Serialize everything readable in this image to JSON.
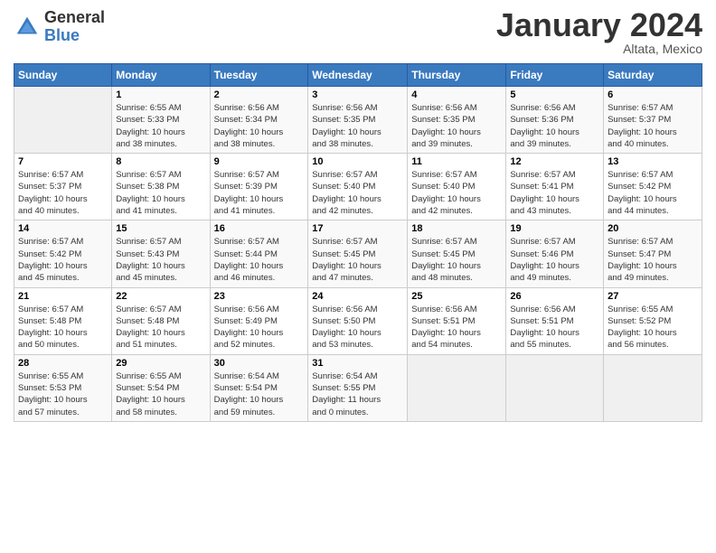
{
  "logo": {
    "general": "General",
    "blue": "Blue"
  },
  "title": "January 2024",
  "subtitle": "Altata, Mexico",
  "days_of_week": [
    "Sunday",
    "Monday",
    "Tuesday",
    "Wednesday",
    "Thursday",
    "Friday",
    "Saturday"
  ],
  "weeks": [
    [
      {
        "num": "",
        "detail": ""
      },
      {
        "num": "1",
        "detail": "Sunrise: 6:55 AM\nSunset: 5:33 PM\nDaylight: 10 hours\nand 38 minutes."
      },
      {
        "num": "2",
        "detail": "Sunrise: 6:56 AM\nSunset: 5:34 PM\nDaylight: 10 hours\nand 38 minutes."
      },
      {
        "num": "3",
        "detail": "Sunrise: 6:56 AM\nSunset: 5:35 PM\nDaylight: 10 hours\nand 38 minutes."
      },
      {
        "num": "4",
        "detail": "Sunrise: 6:56 AM\nSunset: 5:35 PM\nDaylight: 10 hours\nand 39 minutes."
      },
      {
        "num": "5",
        "detail": "Sunrise: 6:56 AM\nSunset: 5:36 PM\nDaylight: 10 hours\nand 39 minutes."
      },
      {
        "num": "6",
        "detail": "Sunrise: 6:57 AM\nSunset: 5:37 PM\nDaylight: 10 hours\nand 40 minutes."
      }
    ],
    [
      {
        "num": "7",
        "detail": "Sunrise: 6:57 AM\nSunset: 5:37 PM\nDaylight: 10 hours\nand 40 minutes."
      },
      {
        "num": "8",
        "detail": "Sunrise: 6:57 AM\nSunset: 5:38 PM\nDaylight: 10 hours\nand 41 minutes."
      },
      {
        "num": "9",
        "detail": "Sunrise: 6:57 AM\nSunset: 5:39 PM\nDaylight: 10 hours\nand 41 minutes."
      },
      {
        "num": "10",
        "detail": "Sunrise: 6:57 AM\nSunset: 5:40 PM\nDaylight: 10 hours\nand 42 minutes."
      },
      {
        "num": "11",
        "detail": "Sunrise: 6:57 AM\nSunset: 5:40 PM\nDaylight: 10 hours\nand 42 minutes."
      },
      {
        "num": "12",
        "detail": "Sunrise: 6:57 AM\nSunset: 5:41 PM\nDaylight: 10 hours\nand 43 minutes."
      },
      {
        "num": "13",
        "detail": "Sunrise: 6:57 AM\nSunset: 5:42 PM\nDaylight: 10 hours\nand 44 minutes."
      }
    ],
    [
      {
        "num": "14",
        "detail": "Sunrise: 6:57 AM\nSunset: 5:42 PM\nDaylight: 10 hours\nand 45 minutes."
      },
      {
        "num": "15",
        "detail": "Sunrise: 6:57 AM\nSunset: 5:43 PM\nDaylight: 10 hours\nand 45 minutes."
      },
      {
        "num": "16",
        "detail": "Sunrise: 6:57 AM\nSunset: 5:44 PM\nDaylight: 10 hours\nand 46 minutes."
      },
      {
        "num": "17",
        "detail": "Sunrise: 6:57 AM\nSunset: 5:45 PM\nDaylight: 10 hours\nand 47 minutes."
      },
      {
        "num": "18",
        "detail": "Sunrise: 6:57 AM\nSunset: 5:45 PM\nDaylight: 10 hours\nand 48 minutes."
      },
      {
        "num": "19",
        "detail": "Sunrise: 6:57 AM\nSunset: 5:46 PM\nDaylight: 10 hours\nand 49 minutes."
      },
      {
        "num": "20",
        "detail": "Sunrise: 6:57 AM\nSunset: 5:47 PM\nDaylight: 10 hours\nand 49 minutes."
      }
    ],
    [
      {
        "num": "21",
        "detail": "Sunrise: 6:57 AM\nSunset: 5:48 PM\nDaylight: 10 hours\nand 50 minutes."
      },
      {
        "num": "22",
        "detail": "Sunrise: 6:57 AM\nSunset: 5:48 PM\nDaylight: 10 hours\nand 51 minutes."
      },
      {
        "num": "23",
        "detail": "Sunrise: 6:56 AM\nSunset: 5:49 PM\nDaylight: 10 hours\nand 52 minutes."
      },
      {
        "num": "24",
        "detail": "Sunrise: 6:56 AM\nSunset: 5:50 PM\nDaylight: 10 hours\nand 53 minutes."
      },
      {
        "num": "25",
        "detail": "Sunrise: 6:56 AM\nSunset: 5:51 PM\nDaylight: 10 hours\nand 54 minutes."
      },
      {
        "num": "26",
        "detail": "Sunrise: 6:56 AM\nSunset: 5:51 PM\nDaylight: 10 hours\nand 55 minutes."
      },
      {
        "num": "27",
        "detail": "Sunrise: 6:55 AM\nSunset: 5:52 PM\nDaylight: 10 hours\nand 56 minutes."
      }
    ],
    [
      {
        "num": "28",
        "detail": "Sunrise: 6:55 AM\nSunset: 5:53 PM\nDaylight: 10 hours\nand 57 minutes."
      },
      {
        "num": "29",
        "detail": "Sunrise: 6:55 AM\nSunset: 5:54 PM\nDaylight: 10 hours\nand 58 minutes."
      },
      {
        "num": "30",
        "detail": "Sunrise: 6:54 AM\nSunset: 5:54 PM\nDaylight: 10 hours\nand 59 minutes."
      },
      {
        "num": "31",
        "detail": "Sunrise: 6:54 AM\nSunset: 5:55 PM\nDaylight: 11 hours\nand 0 minutes."
      },
      {
        "num": "",
        "detail": ""
      },
      {
        "num": "",
        "detail": ""
      },
      {
        "num": "",
        "detail": ""
      }
    ]
  ]
}
